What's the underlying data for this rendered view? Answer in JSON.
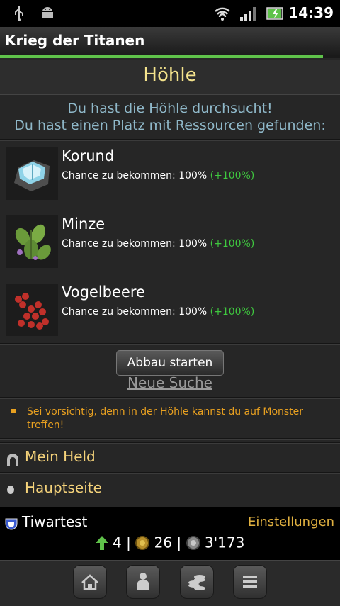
{
  "status_bar": {
    "time": "14:39"
  },
  "app": {
    "title": "Krieg der Titanen",
    "progress_fraction": 0.95
  },
  "cave": {
    "title": "Höhle",
    "message_line1": "Du hast die Höhle durchsucht!",
    "message_line2": "Du hast einen Platz mit Ressourcen gefunden:"
  },
  "resources": [
    {
      "name": "Korund",
      "chance_text": "Chance zu bekommen: 100%",
      "bonus": "(+100%)"
    },
    {
      "name": "Minze",
      "chance_text": "Chance zu bekommen: 100%",
      "bonus": "(+100%)"
    },
    {
      "name": "Vogelbeere",
      "chance_text": "Chance zu bekommen: 100%",
      "bonus": "(+100%)"
    }
  ],
  "actions": {
    "start_label": "Abbau starten",
    "new_search_label": "Neue Suche"
  },
  "warning": "Sei vorsichtig, denn in der Höhle kannst du auf Monster treffen!",
  "menu": [
    {
      "label": "Mein Held",
      "icon": "hero-icon"
    },
    {
      "label": "Hauptseite",
      "icon": "home-bullet-icon"
    }
  ],
  "player": {
    "name": "Tiwartest",
    "settings_label": "Einstellungen",
    "level": "4",
    "gold": "26",
    "silver": "3'173",
    "separator": "|"
  },
  "nav": [
    "home-icon",
    "person-icon",
    "coins-icon",
    "menu-icon"
  ],
  "colors": {
    "accent_green": "#5fc24a",
    "title_yellow": "#f4e38c",
    "bonus_green": "#3fc93f",
    "warning_orange": "#e8a020"
  }
}
